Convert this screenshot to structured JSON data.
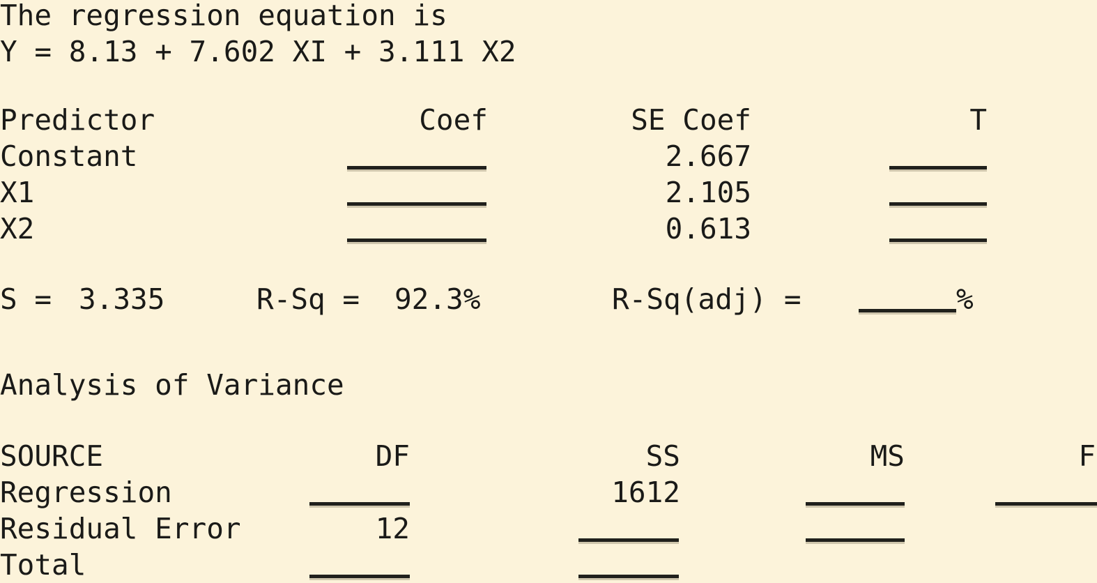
{
  "document": {
    "type": "minitab-regression-output",
    "background_color": "#fcf3da",
    "text_color": "#1a1a18",
    "rule_color": "#20201c"
  },
  "equation_block": {
    "heading": "The regression equation is",
    "equation": "Y = 8.13 + 7.602 XI + 3.111 X2"
  },
  "predictor_table": {
    "headers": {
      "predictor": "Predictor",
      "coef": "Coef",
      "se_coef": "SE Coef",
      "t": "T"
    },
    "rows": [
      {
        "predictor": "Constant",
        "coef": "",
        "se_coef": "2.667",
        "t": ""
      },
      {
        "predictor": "X1",
        "coef": "",
        "se_coef": "2.105",
        "t": ""
      },
      {
        "predictor": "X2",
        "coef": "",
        "se_coef": "0.613",
        "t": ""
      }
    ]
  },
  "summary_line": {
    "s_label": "S =",
    "s_value": "3.335",
    "rsq_label": "R-Sq =",
    "rsq_value": "92.3%",
    "rsq_adj_label": "R-Sq(adj) =",
    "rsq_adj_value": "",
    "rsq_adj_suffix": "%"
  },
  "anova": {
    "title": "Analysis of Variance",
    "headers": {
      "source": "SOURCE",
      "df": "DF",
      "ss": "SS",
      "ms": "MS",
      "f": "F"
    },
    "rows": [
      {
        "source": "Regression",
        "df": "",
        "ss": "1612",
        "ms": "",
        "f": ""
      },
      {
        "source": "Residual Error",
        "df": "12",
        "ss": "",
        "ms": "",
        "f": null
      },
      {
        "source": "Total",
        "df": "",
        "ss": "",
        "ms": null,
        "f": null
      }
    ]
  }
}
